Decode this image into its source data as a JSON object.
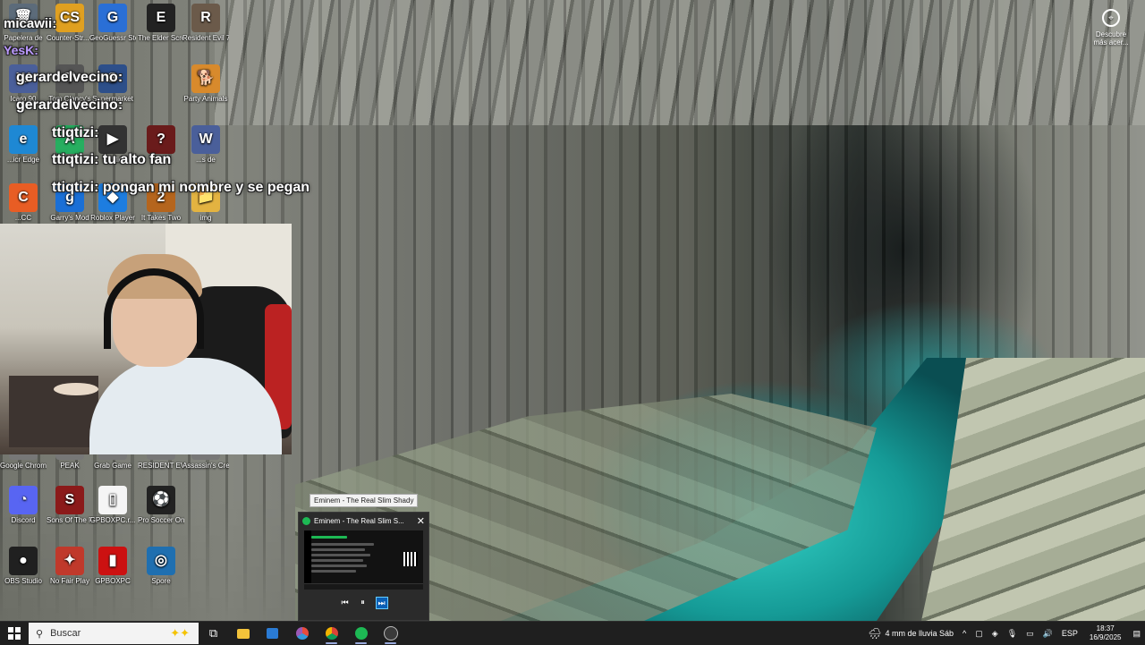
{
  "desktop_icons": [
    {
      "id": "recycle",
      "label": "Papelera de",
      "glyph": "🗑",
      "bg": "#5c6b7a"
    },
    {
      "id": "cs",
      "label": "Counter-Str... 2",
      "glyph": "CS",
      "bg": "#e0a020"
    },
    {
      "id": "geoguessr",
      "label": "GeoGuessr Steam E...",
      "glyph": "G",
      "bg": "#2a6fd6"
    },
    {
      "id": "elderscrolls",
      "label": "The Elder Scrolls ...",
      "glyph": "E",
      "bg": "#222"
    },
    {
      "id": "re7",
      "label": "Resident Evil 7 Biohazard",
      "glyph": "R",
      "bg": "#6b5a4a"
    },
    {
      "id": "icaro",
      "label": "Icaro 90",
      "glyph": "W",
      "bg": "#4a5f9a"
    },
    {
      "id": "tomclancy",
      "label": "Tom Clancy's",
      "glyph": "T",
      "bg": "#555"
    },
    {
      "id": "supermarket",
      "label": "Supermarket",
      "glyph": "S",
      "bg": "#2d4f8a"
    },
    {
      "id": "party",
      "label": "Party Animals",
      "glyph": "🐕",
      "bg": "#d88a2c"
    },
    {
      "id": "edge",
      "label": "...icr Edge",
      "glyph": "e",
      "bg": "#1e88d4"
    },
    {
      "id": "app",
      "label": "App",
      "glyph": "A",
      "bg": "#27ae60"
    },
    {
      "id": "studio",
      "label": "Studio",
      "glyph": "▶",
      "bg": "#333"
    },
    {
      "id": "game8",
      "label": "...",
      "glyph": "?",
      "bg": "#6a1b1b"
    },
    {
      "id": "gamede",
      "label": "...s de",
      "glyph": "W",
      "bg": "#4a5f9a"
    },
    {
      "id": "cc",
      "label": "...CC",
      "glyph": "C",
      "bg": "#e85d24"
    },
    {
      "id": "garrysmod",
      "label": "Garry's Mod",
      "glyph": "g",
      "bg": "#1a6fd6"
    },
    {
      "id": "roblox",
      "label": "Roblox Player",
      "glyph": "◆",
      "bg": "#1d7de0"
    },
    {
      "id": "ittakestwo",
      "label": "It Takes Two",
      "glyph": "2",
      "bg": "#b5651d"
    },
    {
      "id": "img",
      "label": "img",
      "glyph": "📁",
      "bg": "#e3b341"
    },
    {
      "id": "chrome",
      "label": "Google Chrome",
      "glyph": "◉",
      "bg": "#777"
    },
    {
      "id": "peak",
      "label": "PEAK",
      "glyph": "P",
      "bg": "#777"
    },
    {
      "id": "grabgame",
      "label": "Grab Game",
      "glyph": "G",
      "bg": "#777"
    },
    {
      "id": "re2",
      "label": "RESIDENT EVIL 2",
      "glyph": "R",
      "bg": "#777"
    },
    {
      "id": "assassins",
      "label": "Assassin's Creed I",
      "glyph": "A",
      "bg": "#777"
    },
    {
      "id": "discord",
      "label": "Discord",
      "glyph": "◔",
      "bg": "#5865f2"
    },
    {
      "id": "sonsforest",
      "label": "Sons Of The Forest",
      "glyph": "S",
      "bg": "#8b1a1a"
    },
    {
      "id": "gpboxpcr",
      "label": "GPBOXPC.r...",
      "glyph": "▯",
      "bg": "#f5f5f5"
    },
    {
      "id": "prosoccer",
      "label": "Pro Soccer Online",
      "glyph": "⚽",
      "bg": "#222"
    },
    {
      "id": "obs",
      "label": "OBS Studio",
      "glyph": "●",
      "bg": "#202020"
    },
    {
      "id": "nofairplay",
      "label": "No Fair Play",
      "glyph": "✦",
      "bg": "#c0392b"
    },
    {
      "id": "gpboxpc",
      "label": "GPBOXPC",
      "glyph": "▮",
      "bg": "#cc1111"
    },
    {
      "id": "spore",
      "label": "Spore",
      "glyph": "◎",
      "bg": "#1f6fb0"
    }
  ],
  "chat_overlay": [
    {
      "text": "micawii:"
    },
    {
      "text": "YesK:"
    },
    {
      "text": "gerardelvecino:"
    },
    {
      "text": "gerardelvecino:"
    },
    {
      "text": "ttiqtizi:"
    },
    {
      "text": "ttiqtizi: tu alto fan"
    },
    {
      "text": "ttiqtizi: pongan mi nombre y se pegan"
    }
  ],
  "discover": {
    "label": "Descubre más acer..."
  },
  "spotify_tooltip": "Eminem - The Real Slim Shady",
  "spotify_thumbnail": {
    "title": "Eminem - The Real Slim S...",
    "controls": [
      "prev",
      "pause",
      "next"
    ]
  },
  "taskbar": {
    "search_placeholder": "Buscar",
    "apps": [
      "task-view",
      "file-explorer",
      "microsoft-store",
      "browser-2",
      "chrome",
      "spotify",
      "obs"
    ],
    "weather": "4 mm de lluvia Sáb",
    "language": "ESP",
    "time": "18:37",
    "date": "16/9/2025"
  }
}
